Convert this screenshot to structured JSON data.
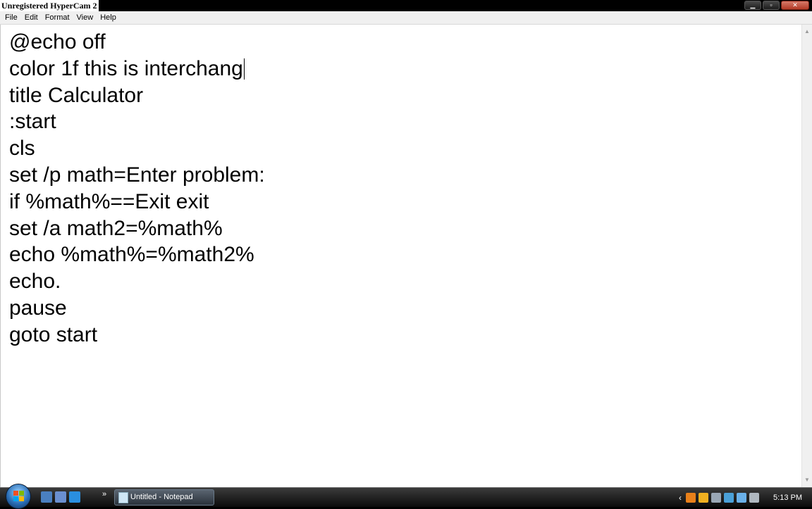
{
  "watermark": "Unregistered HyperCam 2",
  "window": {
    "minimize_glyph": "▁",
    "maximize_glyph": "▫",
    "close_glyph": "✕"
  },
  "menu": [
    "File",
    "Edit",
    "Format",
    "View",
    "Help"
  ],
  "editor": {
    "lines": [
      "@echo off",
      "color 1f this is interchang",
      "title Calculator",
      ":start",
      "cls",
      "set /p math=Enter problem:",
      "if %math%==Exit exit",
      "set /a math2=%math%",
      "echo %math%=%math2%",
      "echo.",
      "pause",
      "goto start"
    ]
  },
  "scrollbar": {
    "up_glyph": "▲",
    "down_glyph": "▼"
  },
  "taskbar": {
    "quicklaunch_chevron": "»",
    "active_task": "Untitled - Notepad",
    "tray_arrow": "‹",
    "clock": "5:13 PM"
  },
  "colors": {
    "start_flag": [
      "#f25022",
      "#7fba00",
      "#00a4ef",
      "#ffb900"
    ],
    "quicklaunch": [
      "#4a7fc0",
      "#6a8fd0",
      "#2a8fe0"
    ],
    "tray": [
      "#e8801a",
      "#f0b020",
      "#9aa7b5",
      "#4aa0d8",
      "#6ab0e8",
      "#b0b8c0"
    ]
  }
}
